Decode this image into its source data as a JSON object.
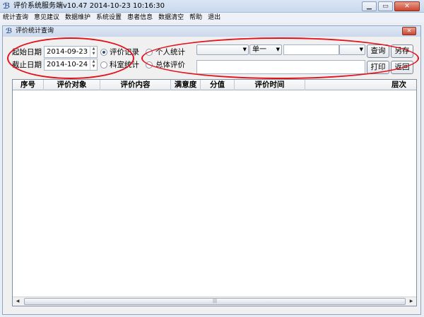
{
  "window": {
    "title": "评价系统服务端v10.47      2014-10-23 10:16:30",
    "min": "0",
    "max": "1",
    "close": "r"
  },
  "menu": [
    "统计查询",
    "意见建议",
    "数据维护",
    "系统设置",
    "患者信息",
    "数据清空",
    "帮助",
    "退出"
  ],
  "child": {
    "title": "评价统计查询",
    "close": "x"
  },
  "dates": {
    "start_label": "起始日期",
    "start_value": "2014-09-23",
    "end_label": "截止日期",
    "end_value": "2014-10-24"
  },
  "mode_options": [
    {
      "label": "评价记录",
      "selected": true
    },
    {
      "label": "科室统计",
      "selected": false
    }
  ],
  "scope_options": [
    {
      "label": "个人统计",
      "selected": false
    },
    {
      "label": "总体评价",
      "selected": false
    }
  ],
  "filters": {
    "combo1_value": "",
    "combo2_value": "单一",
    "combo3_value": "",
    "text1_value": "",
    "text2_value": ""
  },
  "buttons": {
    "query": "查询",
    "save_as": "另存",
    "print": "打印",
    "back": "返回"
  },
  "table": {
    "columns": [
      "序号",
      "评价对象",
      "评价内容",
      "满意度",
      "分值",
      "评价时间",
      "层次"
    ],
    "rows": []
  },
  "scrollbar": {
    "left_arrow": "◀",
    "right_arrow": "▶",
    "grip": "|||"
  }
}
